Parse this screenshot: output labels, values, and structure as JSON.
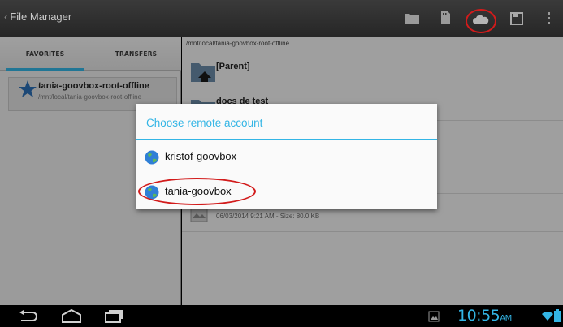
{
  "app": {
    "title": "File Manager",
    "back_glyph": "‹"
  },
  "actionbar": {
    "icons": [
      "new-folder-icon",
      "sd-card-icon",
      "cloud-icon",
      "save-icon",
      "overflow-menu-icon"
    ],
    "highlighted_icon": "cloud-icon"
  },
  "left_panel": {
    "tabs": [
      {
        "label": "FAVORITES",
        "selected": true
      },
      {
        "label": "TRANSFERS",
        "selected": false
      }
    ],
    "favorites": [
      {
        "name": "tania-goovbox-root-offline",
        "path": "/mnt/local/tania-goovbox-root-offline"
      }
    ]
  },
  "right_panel": {
    "current_path": "/mnt/local/tania-goovbox-root-offline",
    "items": [
      {
        "name": "[Parent]"
      },
      {
        "name": "docs de test"
      },
      {
        "meta": "06/03/2014 9:21 AM - Size: 80.0 KB"
      }
    ]
  },
  "dialog": {
    "title": "Choose remote account",
    "options": [
      {
        "label": "kristof-goovbox"
      },
      {
        "label": "tania-goovbox",
        "highlighted": true
      }
    ]
  },
  "status": {
    "time": "10:55",
    "ampm": "AM"
  },
  "colors": {
    "accent": "#33b5e5",
    "annotation": "#d21b1b",
    "actionbar": "#2e2e2e"
  }
}
